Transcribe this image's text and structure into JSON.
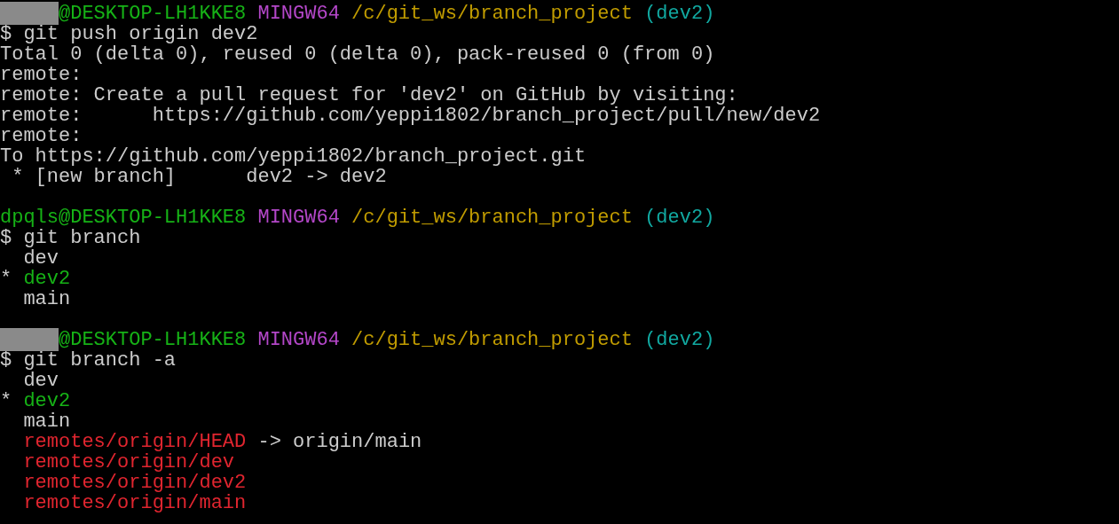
{
  "terminal": {
    "lines": [
      {
        "kind": "output",
        "segments": [
          {
            "kind": "redacted"
          },
          {
            "kind": "text",
            "text": "@DESKTOP-LH1KKE8",
            "color": "#16b216"
          },
          {
            "kind": "text",
            "text": "MINGW64",
            "color": "#b447c9"
          },
          {
            "kind": "text",
            "text": "/c/git_ws/branch_project",
            "color": "#c19c00"
          },
          {
            "kind": "text",
            "text": "(dev2)",
            "color": "#11a8a0"
          }
        ]
      },
      {
        "kind": "output",
        "segments": [
          {
            "kind": "text",
            "text": "$ git push origin dev2",
            "color": "#cccccc"
          }
        ]
      },
      {
        "kind": "output",
        "segments": [
          {
            "kind": "text",
            "text": "Total 0 (delta 0), reused 0 (delta 0), pack-reused 0 (from 0)",
            "color": "#cccccc"
          }
        ]
      },
      {
        "kind": "output",
        "segments": [
          {
            "kind": "text",
            "text": "remote:",
            "color": "#cccccc"
          }
        ]
      },
      {
        "kind": "output",
        "segments": [
          {
            "kind": "text",
            "text": "remote: Create a pull request for 'dev2' on GitHub by visiting:",
            "color": "#cccccc"
          }
        ]
      },
      {
        "kind": "output",
        "segments": [
          {
            "kind": "text",
            "text": "remote:      https://github.com/yeppi1802/branch_project/pull/new/dev2",
            "color": "#cccccc"
          }
        ]
      },
      {
        "kind": "output",
        "segments": [
          {
            "kind": "text",
            "text": "remote:",
            "color": "#cccccc"
          }
        ]
      },
      {
        "kind": "output",
        "segments": [
          {
            "kind": "text",
            "text": "To https://github.com/yeppi1802/branch_project.git",
            "color": "#cccccc"
          }
        ]
      },
      {
        "kind": "output",
        "segments": [
          {
            "kind": "text",
            "text": " * [new branch]      dev2 -> dev2",
            "color": "#cccccc"
          }
        ]
      },
      {
        "kind": "blank"
      },
      {
        "kind": "output",
        "segments": [
          {
            "kind": "text",
            "text": "dpqls@DESKTOP-LH1KKE8",
            "color": "#16b216"
          },
          {
            "kind": "text",
            "text": "MINGW64",
            "color": "#b447c9"
          },
          {
            "kind": "text",
            "text": "/c/git_ws/branch_project",
            "color": "#c19c00"
          },
          {
            "kind": "text",
            "text": "(dev2)",
            "color": "#11a8a0"
          }
        ]
      },
      {
        "kind": "output",
        "segments": [
          {
            "kind": "text",
            "text": "$ git branch",
            "color": "#cccccc"
          }
        ]
      },
      {
        "kind": "output",
        "segments": [
          {
            "kind": "text",
            "text": "  dev",
            "color": "#cccccc"
          }
        ]
      },
      {
        "kind": "output",
        "segments": [
          {
            "kind": "text",
            "text": "*",
            "color": "#cccccc"
          },
          {
            "kind": "text",
            "text": "dev2",
            "color": "#16b216"
          }
        ]
      },
      {
        "kind": "output",
        "segments": [
          {
            "kind": "text",
            "text": "  main",
            "color": "#cccccc"
          }
        ]
      },
      {
        "kind": "blank"
      },
      {
        "kind": "output",
        "segments": [
          {
            "kind": "redacted"
          },
          {
            "kind": "text",
            "text": "@DESKTOP-LH1KKE8",
            "color": "#16b216"
          },
          {
            "kind": "text",
            "text": "MINGW64",
            "color": "#b447c9"
          },
          {
            "kind": "text",
            "text": "/c/git_ws/branch_project",
            "color": "#c19c00"
          },
          {
            "kind": "text",
            "text": "(dev2)",
            "color": "#11a8a0"
          }
        ]
      },
      {
        "kind": "output",
        "segments": [
          {
            "kind": "text",
            "text": "$ git branch -a",
            "color": "#cccccc"
          }
        ]
      },
      {
        "kind": "output",
        "segments": [
          {
            "kind": "text",
            "text": "  dev",
            "color": "#cccccc"
          }
        ]
      },
      {
        "kind": "output",
        "segments": [
          {
            "kind": "text",
            "text": "*",
            "color": "#cccccc"
          },
          {
            "kind": "text",
            "text": "dev2",
            "color": "#16b216"
          }
        ]
      },
      {
        "kind": "output",
        "segments": [
          {
            "kind": "text",
            "text": "  main",
            "color": "#cccccc"
          }
        ]
      },
      {
        "kind": "output",
        "segments": [
          {
            "kind": "text",
            "text": "  remotes/origin/HEAD",
            "color": "#e0252f"
          },
          {
            "kind": "text",
            "text": "-> origin/main",
            "color": "#cccccc"
          }
        ]
      },
      {
        "kind": "output",
        "segments": [
          {
            "kind": "text",
            "text": "  remotes/origin/dev",
            "color": "#e0252f"
          }
        ]
      },
      {
        "kind": "output",
        "segments": [
          {
            "kind": "text",
            "text": "  remotes/origin/dev2",
            "color": "#e0252f"
          }
        ]
      },
      {
        "kind": "output",
        "segments": [
          {
            "kind": "text",
            "text": "  remotes/origin/main",
            "color": "#e0252f"
          }
        ]
      }
    ]
  }
}
